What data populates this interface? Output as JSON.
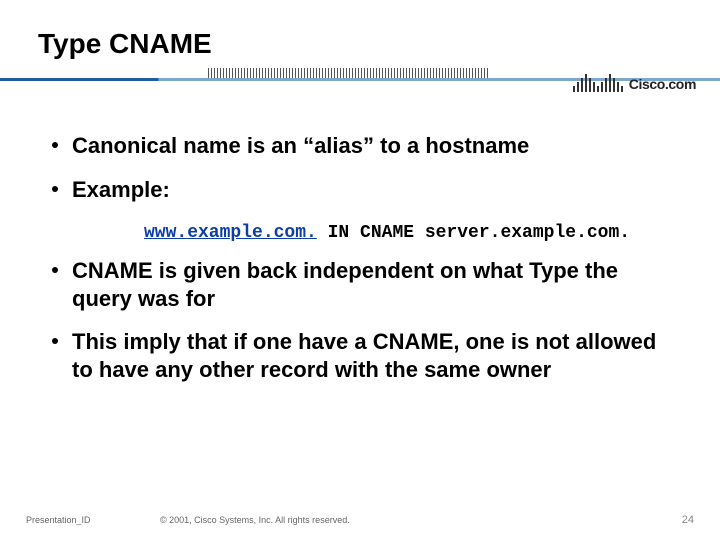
{
  "title": "Type CNAME",
  "logo": {
    "text": "Cisco.com",
    "name": "cisco-logo"
  },
  "bullets": [
    {
      "text": "Canonical name is an “alias” to a hostname"
    },
    {
      "text": "Example:"
    },
    {
      "text": "CNAME is given back independent on what Type the query was for"
    },
    {
      "text": "This imply that if one have a CNAME, one is not allowed to have any other record with the same owner"
    }
  ],
  "code": {
    "link": "www.example.com.",
    "rest": " IN CNAME server.example.com."
  },
  "footer": {
    "presentation_id": "Presentation_ID",
    "copyright": "© 2001, Cisco Systems, Inc. All rights reserved.",
    "page": "24"
  }
}
